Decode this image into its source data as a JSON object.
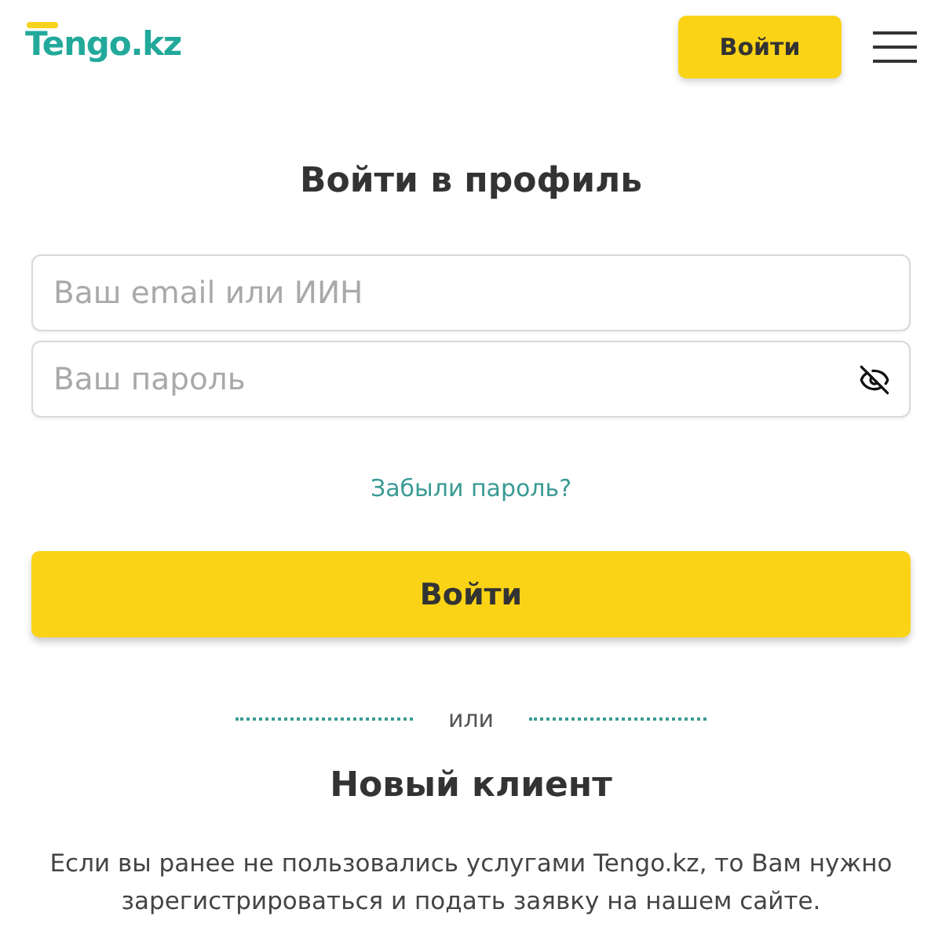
{
  "header": {
    "logo": "Tengo.kz",
    "login_button": "Войти"
  },
  "form": {
    "title": "Войти в профиль",
    "email_field": {
      "placeholder": "Ваш email или ИИН"
    },
    "password_field": {
      "placeholder": "Ваш пароль",
      "show_password": false
    },
    "forgot_link": "Забыли пароль?",
    "submit_button": "Войти"
  },
  "divider": {
    "label": "или"
  },
  "new_client": {
    "title": "Новый клиент",
    "text": "Если вы ранее не пользовались услугами Tengo.kz, то Вам нужно зарегистрироваться и подать заявку на нашем сайте."
  }
}
